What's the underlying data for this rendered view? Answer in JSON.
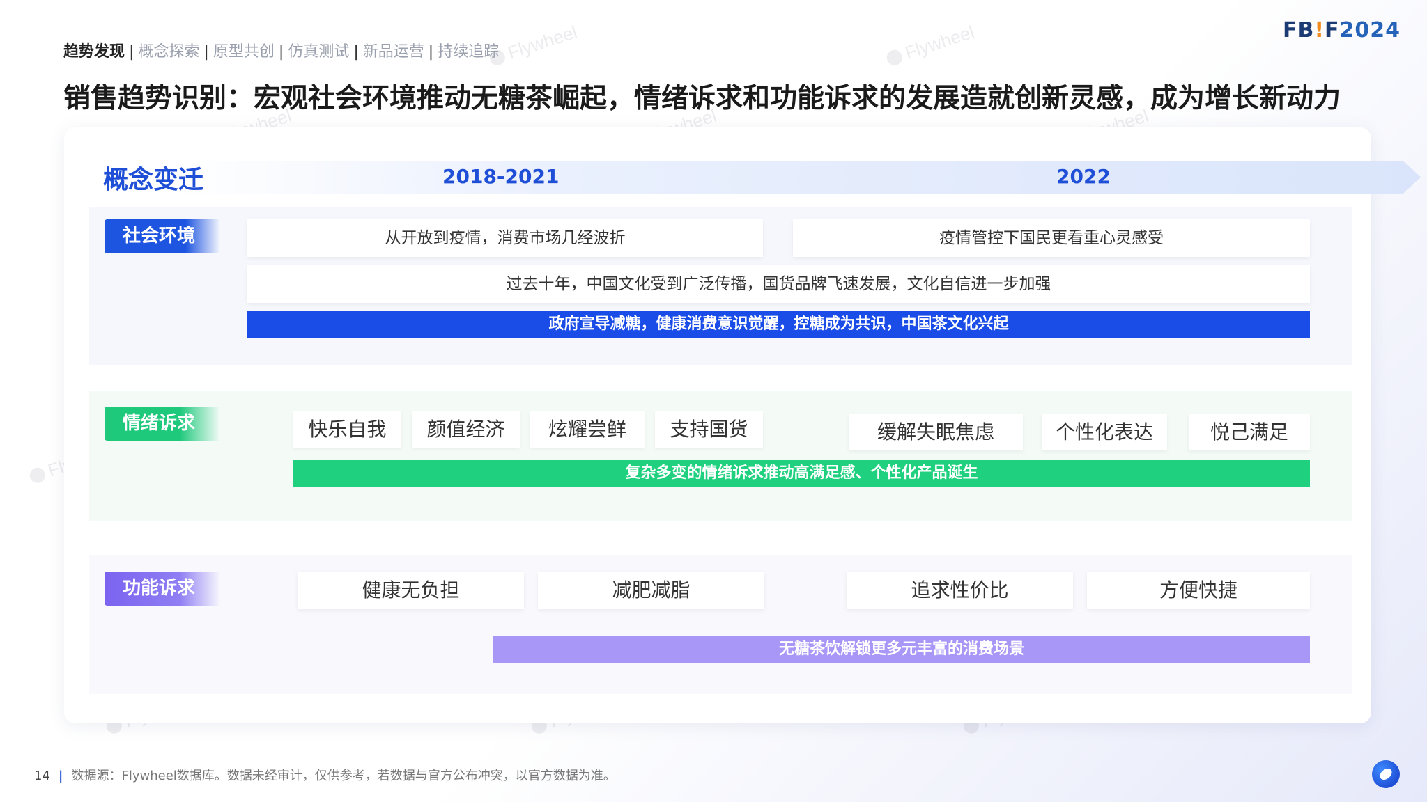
{
  "header": {
    "nav": [
      {
        "label": "趋势发现",
        "active": true
      },
      {
        "label": "概念探索",
        "active": false
      },
      {
        "label": "原型共创",
        "active": false
      },
      {
        "label": "仿真测试",
        "active": false
      },
      {
        "label": "新品运营",
        "active": false
      },
      {
        "label": "持续追踪",
        "active": false
      }
    ],
    "nav_separator": "|",
    "brand": {
      "part1": "FB",
      "part2": "!",
      "part3": "F",
      "part4": "2024"
    },
    "title": "销售趋势识别：宏观社会环境推动无糖茶崛起，情绪诉求和功能诉求的发展造就创新灵感，成为增长新动力"
  },
  "timeline": {
    "label": "概念变迁",
    "period_1": "2018-2021",
    "period_2": "2022"
  },
  "social": {
    "tag": "社会环境",
    "box_1": "从开放到疫情，消费市场几经波折",
    "box_2": "疫情管控下国民更看重心灵感受",
    "box_3": "过去十年，中国文化受到广泛传播，国货品牌飞速发展，文化自信进一步加强",
    "bar": "政府宣导减糖，健康消费意识觉醒，控糖成为共识，中国茶文化兴起"
  },
  "emotion": {
    "tag": "情绪诉求",
    "items_2018": [
      "快乐自我",
      "颜值经济",
      "炫耀尝鲜",
      "支持国货"
    ],
    "items_2022": [
      "缓解失眠焦虑",
      "个性化表达",
      "悦己满足"
    ],
    "bar": "复杂多变的情绪诉求推动高满足感、个性化产品诞生"
  },
  "function": {
    "tag": "功能诉求",
    "items_2018": [
      "健康无负担",
      "减肥减脂"
    ],
    "items_2022": [
      "追求性价比",
      "方便快捷"
    ],
    "bar": "无糖茶饮解锁更多元丰富的消费场景"
  },
  "footer": {
    "page_number": "14",
    "separator": "|",
    "source": "数据源：Flywheel数据库。数据未经审计，仅供参考，若数据与官方公布冲突，以官方数据为准。"
  },
  "watermark": "Flywheel",
  "colors": {
    "primary_blue": "#1f4fd6",
    "green": "#1fd07e",
    "purple": "#a897f6"
  }
}
